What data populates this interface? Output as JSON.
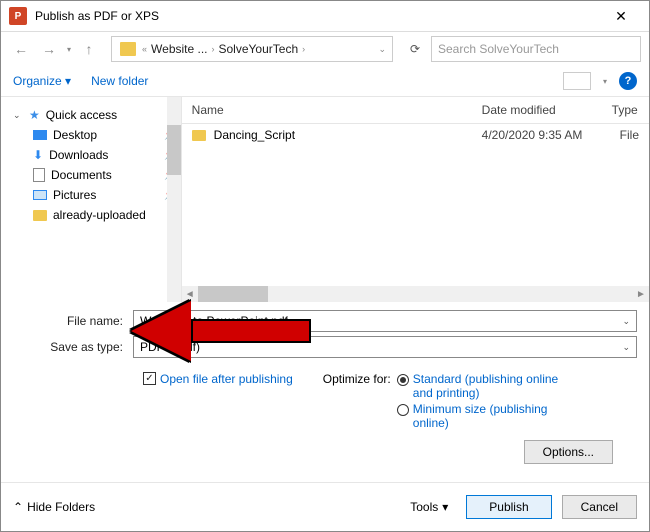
{
  "dialog_title": "Publish as PDF or XPS",
  "breadcrumb": {
    "root_sep": "«",
    "part1": "Website ...",
    "part2": "SolveYourTech"
  },
  "search": {
    "placeholder": "Search SolveYourTech"
  },
  "toolbar": {
    "organize": "Organize",
    "new_folder": "New folder"
  },
  "sidebar": {
    "quick_access": "Quick access",
    "desktop": "Desktop",
    "downloads": "Downloads",
    "documents": "Documents",
    "pictures": "Pictures",
    "already_uploaded": "already-uploaded"
  },
  "columns": {
    "name": "Name",
    "date": "Date modified",
    "type": "Type"
  },
  "files": {
    "row0": {
      "name": "Dancing_Script",
      "date": "4/20/2020 9:35 AM",
      "type": "File"
    }
  },
  "form": {
    "file_name_label": "File name:",
    "file_name_value": "Welcome to PowerPoint.pdf",
    "save_as_type_label": "Save as type:",
    "save_as_type_value": "PDF (*.pdf)",
    "open_after": "Open file after publishing",
    "optimize_label": "Optimize for:",
    "opt_standard": "Standard (publishing online and printing)",
    "opt_min": "Minimum size (publishing online)",
    "options_btn": "Options..."
  },
  "footer": {
    "hide_folders": "Hide Folders",
    "tools": "Tools",
    "publish": "Publish",
    "cancel": "Cancel"
  }
}
